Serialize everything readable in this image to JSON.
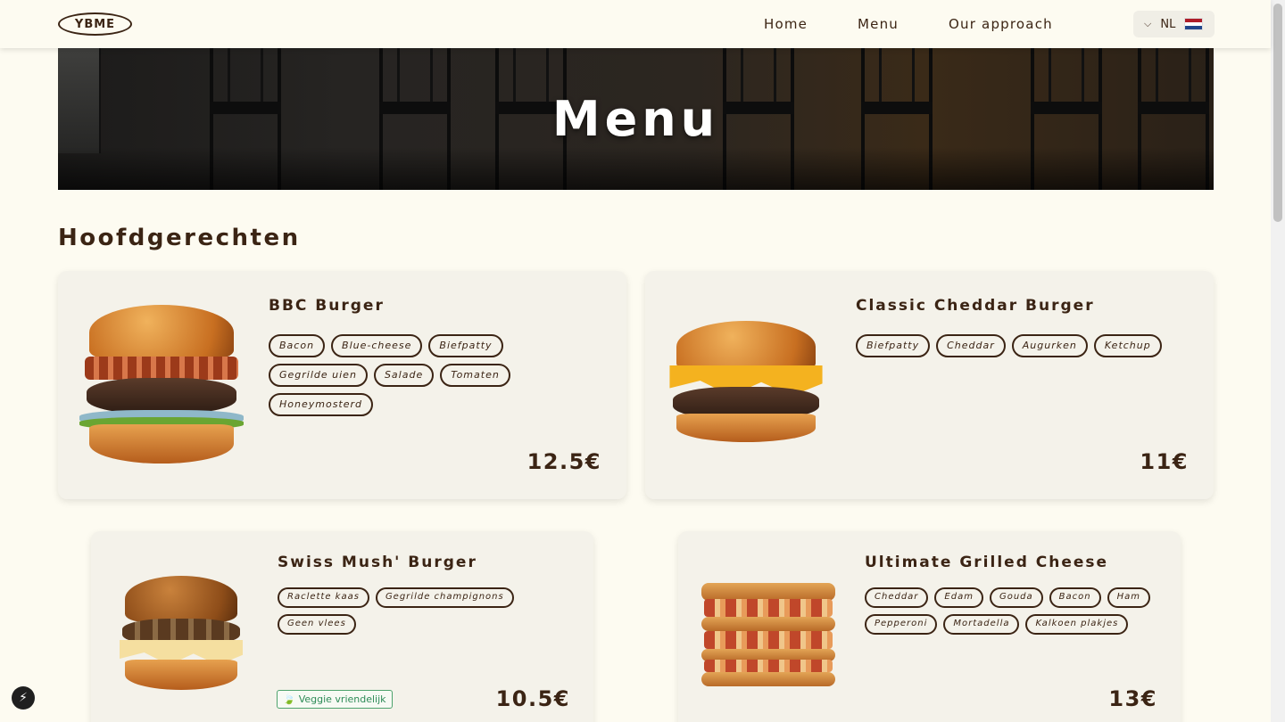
{
  "header": {
    "logo": "YBME",
    "nav": [
      "Home",
      "Menu",
      "Our approach"
    ],
    "language": "NL",
    "flag_colors": [
      "#ae1c28",
      "#ffffff",
      "#21468b"
    ]
  },
  "hero": {
    "title": "Menu"
  },
  "section": {
    "title": "Hoofdgerechten"
  },
  "items": [
    {
      "name": "BBC Burger",
      "tags": [
        "Bacon",
        "Blue-cheese",
        "Biefpatty",
        "Gegrilde uien",
        "Salade",
        "Tomaten",
        "Honeymosterd"
      ],
      "price": "12.5€"
    },
    {
      "name": "Classic Cheddar Burger",
      "tags": [
        "Biefpatty",
        "Cheddar",
        "Augurken",
        "Ketchup"
      ],
      "price": "11€"
    },
    {
      "name": "Swiss Mush' Burger",
      "tags": [
        "Raclette kaas",
        "Gegrilde champignons",
        "Geen vlees"
      ],
      "badge": "Veggie vriendelijk",
      "price": "10.5€"
    },
    {
      "name": "Ultimate Grilled Cheese",
      "tags": [
        "Cheddar",
        "Edam",
        "Gouda",
        "Bacon",
        "Ham",
        "Pepperoni",
        "Mortadella",
        "Kalkoen plakjes"
      ],
      "price": "13€"
    }
  ],
  "colors": {
    "accent": "#3b2414",
    "background": "#fdfbf1",
    "card": "#f4f2ea",
    "veggie": "#2e8b57"
  },
  "icons": {
    "chevron": "chevron-down-icon",
    "leaf": "leaf-icon",
    "fab": "lightning-icon"
  }
}
